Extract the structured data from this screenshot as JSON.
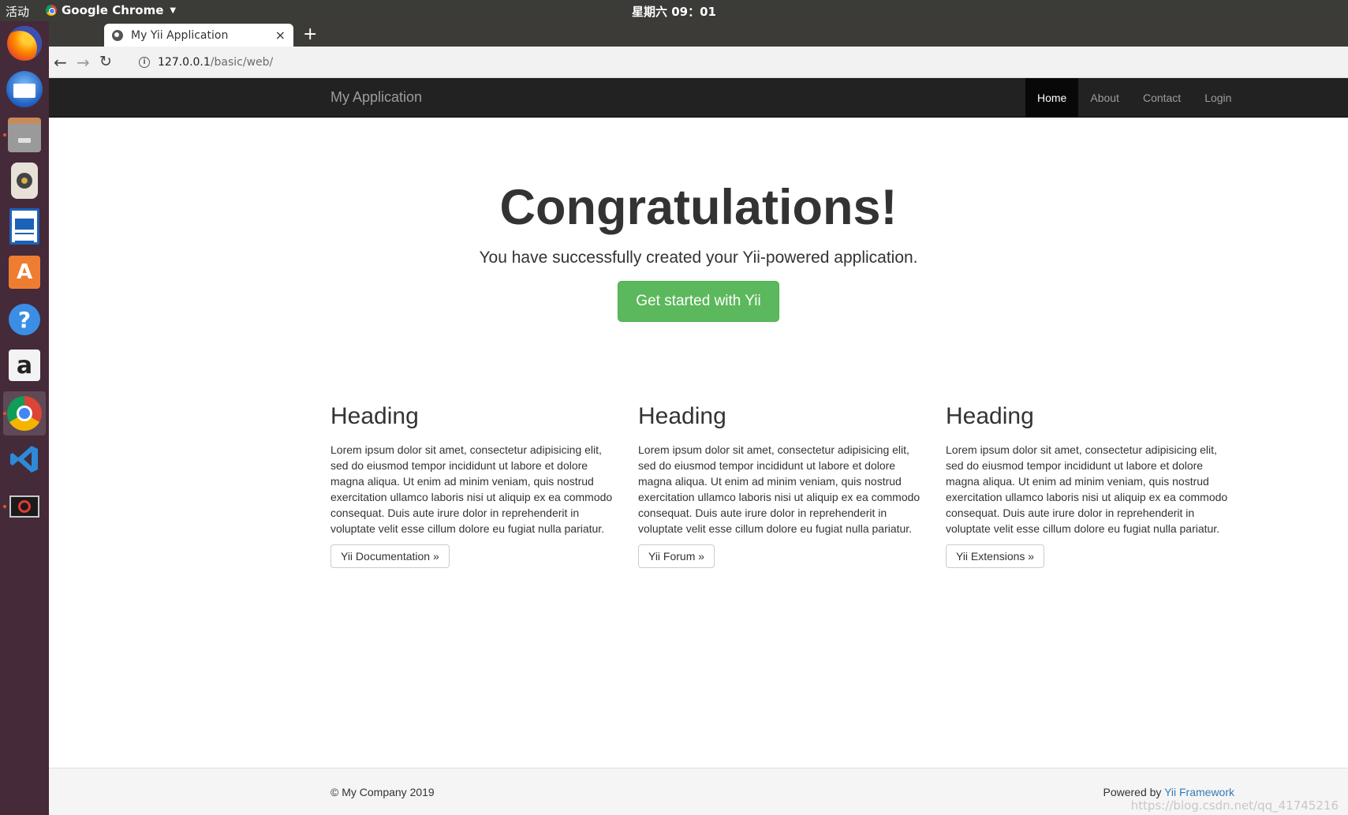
{
  "desktop": {
    "activities": "活动",
    "app_menu_label": "Google Chrome",
    "clock": "星期六 09：01",
    "dock_icons": [
      "firefox-icon",
      "thunderbird-icon",
      "files-icon",
      "rhythmbox-icon",
      "libreoffice-writer-icon",
      "software-center-icon",
      "help-icon",
      "amazon-icon",
      "chrome-icon",
      "vscode-icon",
      "blocked-app-icon"
    ]
  },
  "browser": {
    "tab_title": "My Yii Application",
    "tab_close": "×",
    "new_tab": "+",
    "url_host": "127.0.0.1",
    "url_path": "/basic/web/"
  },
  "page": {
    "navbar": {
      "brand": "My Application",
      "links": [
        "Home",
        "About",
        "Contact",
        "Login"
      ],
      "active_link": "Home"
    },
    "jumbotron": {
      "title": "Congratulations!",
      "lead": "You have successfully created your Yii-powered application.",
      "button": "Get started with Yii"
    },
    "columns": [
      {
        "heading": "Heading",
        "text": "Lorem ipsum dolor sit amet, consectetur adipisicing elit, sed do eiusmod tempor incididunt ut labore et dolore magna aliqua. Ut enim ad minim veniam, quis nostrud exercitation ullamco laboris nisi ut aliquip ex ea commodo consequat. Duis aute irure dolor in reprehenderit in voluptate velit esse cillum dolore eu fugiat nulla pariatur.",
        "button": "Yii Documentation »"
      },
      {
        "heading": "Heading",
        "text": "Lorem ipsum dolor sit amet, consectetur adipisicing elit, sed do eiusmod tempor incididunt ut labore et dolore magna aliqua. Ut enim ad minim veniam, quis nostrud exercitation ullamco laboris nisi ut aliquip ex ea commodo consequat. Duis aute irure dolor in reprehenderit in voluptate velit esse cillum dolore eu fugiat nulla pariatur.",
        "button": "Yii Forum »"
      },
      {
        "heading": "Heading",
        "text": "Lorem ipsum dolor sit amet, consectetur adipisicing elit, sed do eiusmod tempor incididunt ut labore et dolore magna aliqua. Ut enim ad minim veniam, quis nostrud exercitation ullamco laboris nisi ut aliquip ex ea commodo consequat. Duis aute irure dolor in reprehenderit in voluptate velit esse cillum dolore eu fugiat nulla pariatur.",
        "button": "Yii Extensions »"
      }
    ],
    "footer": {
      "copyright": "© My Company 2019",
      "powered_prefix": "Powered by ",
      "powered_link": "Yii Framework"
    }
  },
  "watermark": "https://blog.csdn.net/qq_41745216",
  "colors": {
    "navbar_bg": "#222222",
    "success": "#5cb85c",
    "link": "#337ab7",
    "dock_bg": "#452a3a"
  }
}
